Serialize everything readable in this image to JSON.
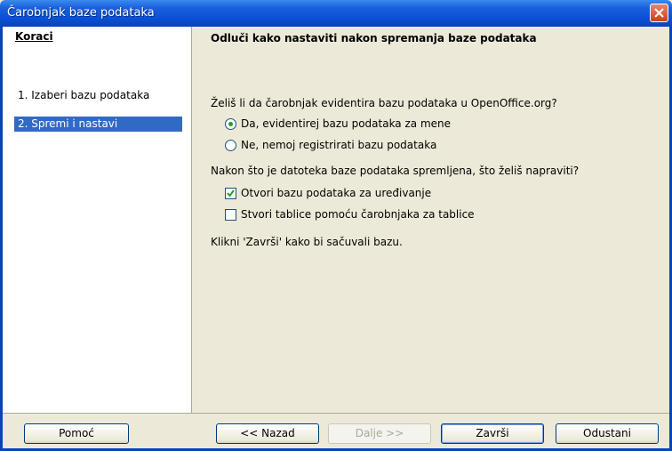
{
  "window": {
    "title": "Čarobnjak baze podataka"
  },
  "sidebar": {
    "heading": "Koraci",
    "steps": [
      {
        "label": "1.  Izaberi bazu podataka",
        "active": false
      },
      {
        "label": "2.  Spremi i nastavi",
        "active": true
      }
    ]
  },
  "main": {
    "heading": "Odluči kako nastaviti nakon spremanja baze podataka",
    "register_question": "Želiš li da čarobnjak evidentira bazu podataka u  OpenOffice.org?",
    "radio_yes": "Da, evidentirej bazu podataka za mene",
    "radio_no": "Ne, nemoj registrirati bazu podataka",
    "after_save_question": "Nakon što je datoteka baze podataka spremljena, što želiš napraviti?",
    "check_open": "Otvori bazu podataka za uređivanje",
    "check_tables": "Stvori tablice pomoću čarobnjaka za tablice",
    "finish_hint": "Klikni 'Završi' kako bi sačuvali bazu.",
    "radio_yes_selected": true,
    "check_open_checked": true,
    "check_tables_checked": false
  },
  "buttons": {
    "help": "Pomoć",
    "back": "<< Nazad",
    "next": "Dalje >>",
    "finish": "Završi",
    "cancel": "Odustani"
  },
  "colors": {
    "selection": "#316ac5",
    "title_bar": "#0a4fd6"
  }
}
